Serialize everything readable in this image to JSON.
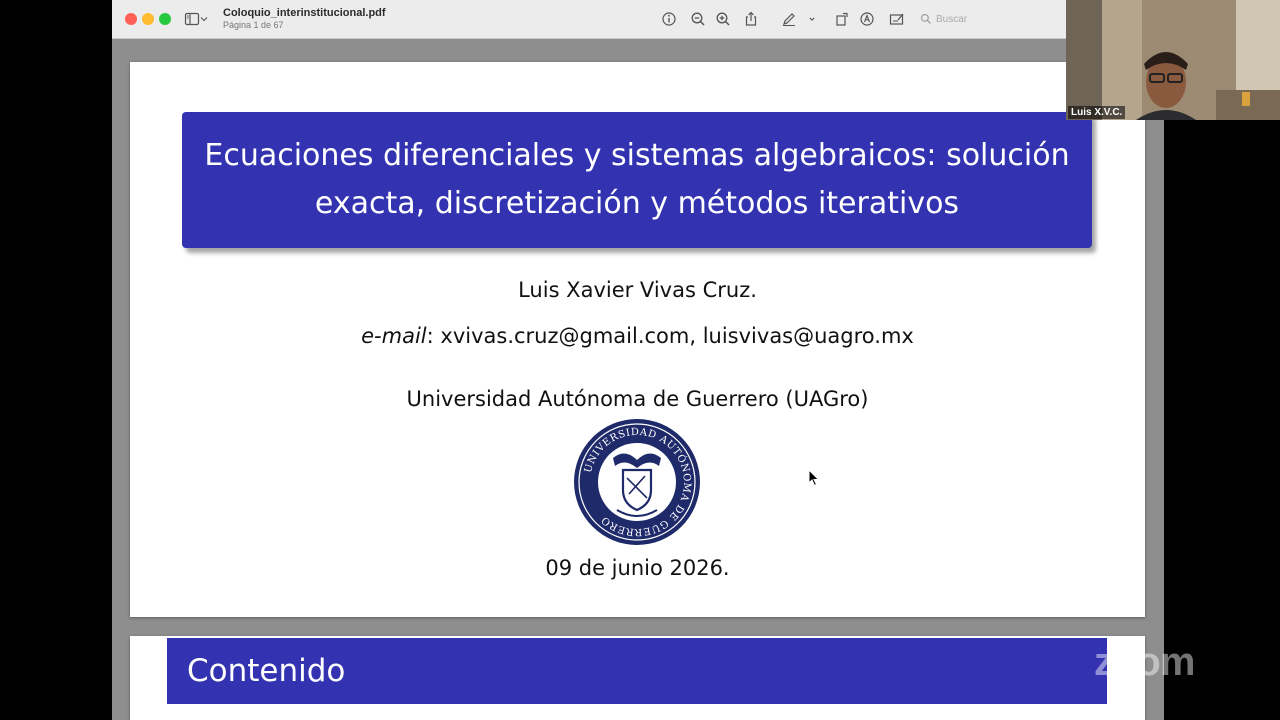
{
  "viewer": {
    "file_name": "Coloquio_interinstitucional.pdf",
    "page_indicator": "Página 1 de 67",
    "search_placeholder": "Buscar"
  },
  "slide1": {
    "title": "Ecuaciones diferenciales y sistemas algebraicos: solución exacta, discretización y métodos iterativos",
    "author": "Luis Xavier Vivas Cruz.",
    "email_label": "e-mail",
    "email_rest": ": xvivas.cruz@gmail.com,   luisvivas@uagro.mx",
    "institution": "Universidad Autónoma de Guerrero (UAGro)",
    "seal_text": "UNIVERSIDAD AUTÓNOMA DE GUERRERO",
    "date": "09 de junio 2026."
  },
  "slide2": {
    "title": "Contenido"
  },
  "participant": {
    "name": "Luis X.V.C."
  },
  "branding": {
    "zoom": "zoom"
  },
  "colors": {
    "slide_blue": "#3333b2",
    "seal_navy": "#1f2a6b",
    "traffic_red": "#ff5f57",
    "traffic_yellow": "#febc2e",
    "traffic_green": "#28c840"
  },
  "icons": [
    "sidebar-toggle-icon",
    "chevron-down-icon",
    "info-icon",
    "zoom-out-icon",
    "zoom-in-icon",
    "share-icon",
    "markup-pen-icon",
    "rotate-icon",
    "markup-circle-icon",
    "form-fill-icon",
    "search-icon",
    "pointer-cursor-icon"
  ]
}
